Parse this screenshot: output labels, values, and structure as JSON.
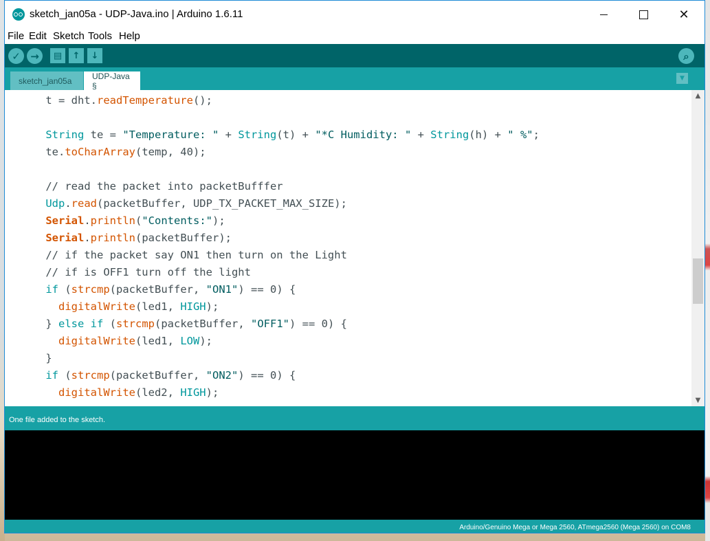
{
  "window": {
    "title": "sketch_jan05a - UDP-Java.ino | Arduino 1.6.11",
    "minimize_icon": "minimize-icon",
    "maximize_icon": "maximize-icon",
    "close_icon": "close-icon",
    "close_glyph": "✕"
  },
  "menu": {
    "items": [
      "File",
      "Edit",
      "Sketch",
      "Tools",
      "Help"
    ]
  },
  "toolbar": {
    "verify_glyph": "✓",
    "upload_glyph": "→",
    "new_glyph": "▤",
    "open_glyph": "↑",
    "save_glyph": "↓",
    "serial_monitor_glyph": "⌕",
    "icons": [
      "verify-icon",
      "upload-icon",
      "new-icon",
      "open-icon",
      "save-icon",
      "serial-monitor-icon"
    ]
  },
  "tabs": {
    "items": [
      "sketch_jan05a",
      "UDP-Java §"
    ],
    "active": "UDP-Java §",
    "menu_glyph": "▼"
  },
  "editor": {
    "lines": [
      "    t = dht.readTemperature();",
      "",
      "    String te = \"Temperature: \" + String(t) + \"*C Humidity: \" + String(h) + \" %\";",
      "    te.toCharArray(temp, 40);",
      "",
      "    // read the packet into packetBufffer",
      "    Udp.read(packetBuffer, UDP_TX_PACKET_MAX_SIZE);",
      "    Serial.println(\"Contents:\");",
      "    Serial.println(packetBuffer);",
      "    // if the packet say ON1 then turn on the Light",
      "    // if is OFF1 turn off the light",
      "    if (strcmp(packetBuffer, \"ON1\") == 0) {",
      "      digitalWrite(led1, HIGH);",
      "    } else if (strcmp(packetBuffer, \"OFF1\") == 0) {",
      "      digitalWrite(led1, LOW);",
      "    }",
      "    if (strcmp(packetBuffer, \"ON2\") == 0) {",
      "      digitalWrite(led2, HIGH);"
    ],
    "scroll_up_glyph": "▲",
    "scroll_down_glyph": "▼"
  },
  "status": {
    "message": "One file added to the sketch."
  },
  "board": {
    "info": "Arduino/Genuino Mega or Mega 2560, ATmega2560 (Mega 2560) on COM8"
  },
  "colors": {
    "toolbar": "#006468",
    "tabbar": "#17a1a5",
    "keyword": "#d35400",
    "type": "#00979c"
  }
}
